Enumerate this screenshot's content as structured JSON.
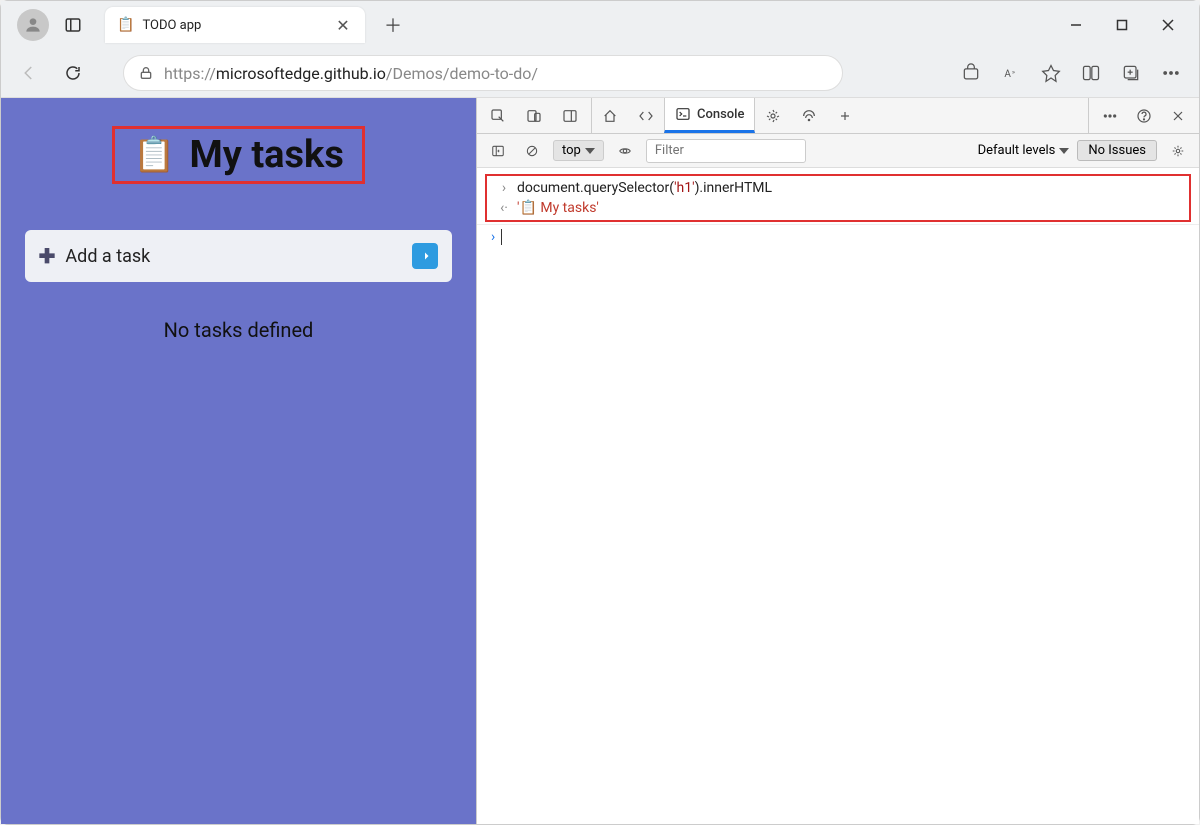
{
  "browser": {
    "tab": {
      "favicon": "📋",
      "title": "TODO app"
    },
    "url": {
      "scheme": "https://",
      "host": "microsoftedge.github.io",
      "path": "/Demos/demo-to-do/"
    }
  },
  "page": {
    "heading_emoji": "📋",
    "heading_text": "My tasks",
    "add_task_placeholder": "Add a task",
    "no_tasks_text": "No tasks defined"
  },
  "devtools": {
    "tabs": {
      "console": "Console"
    },
    "toolbar": {
      "context": "top",
      "filter_placeholder": "Filter",
      "levels_label": "Default levels",
      "no_issues": "No Issues"
    },
    "console": {
      "input_pre": "document.querySelector(",
      "input_arg": "'h1'",
      "input_post": ").innerHTML",
      "output": "'📋 My tasks'"
    }
  }
}
